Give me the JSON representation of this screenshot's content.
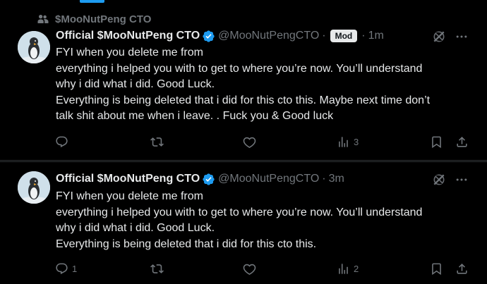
{
  "community": {
    "label": "$MooNutPeng CTO"
  },
  "posts": [
    {
      "display_name": "Official $MooNutPeng CTO",
      "handle": "@MooNutPengCTO",
      "separator": "·",
      "badge": "Mod",
      "time": "1m",
      "lines": [
        "FYI when you delete me from",
        "everything i helped you with to get to where you’re now. You’ll understand",
        "why i did what i did. Good Luck.",
        "Everything is being deleted that i did for this cto this. Maybe next time don’t",
        "talk shit about me when i leave. . Fuck you & Good luck"
      ],
      "replies": "",
      "reposts": "",
      "likes": "",
      "views": "3"
    },
    {
      "display_name": "Official $MooNutPeng CTO",
      "handle": "@MooNutPengCTO",
      "separator": "·",
      "time": "3m",
      "lines": [
        "FYI when you delete me from",
        "everything i helped you with to get to where you’re now. You’ll understand",
        "why i did what i did. Good Luck.",
        "Everything is being deleted that i did for this cto this."
      ],
      "replies": "1",
      "reposts": "",
      "likes": "",
      "views": "2"
    }
  ],
  "colors": {
    "accent": "#1d9bf0",
    "muted": "#71767b",
    "text": "#e7e9ea",
    "border": "#2f3336",
    "background": "#000000"
  },
  "icons": [
    "community-icon",
    "verified-badge-icon",
    "grok-icon",
    "more-icon",
    "reply-icon",
    "repost-icon",
    "like-icon",
    "views-icon",
    "bookmark-icon",
    "share-icon"
  ]
}
